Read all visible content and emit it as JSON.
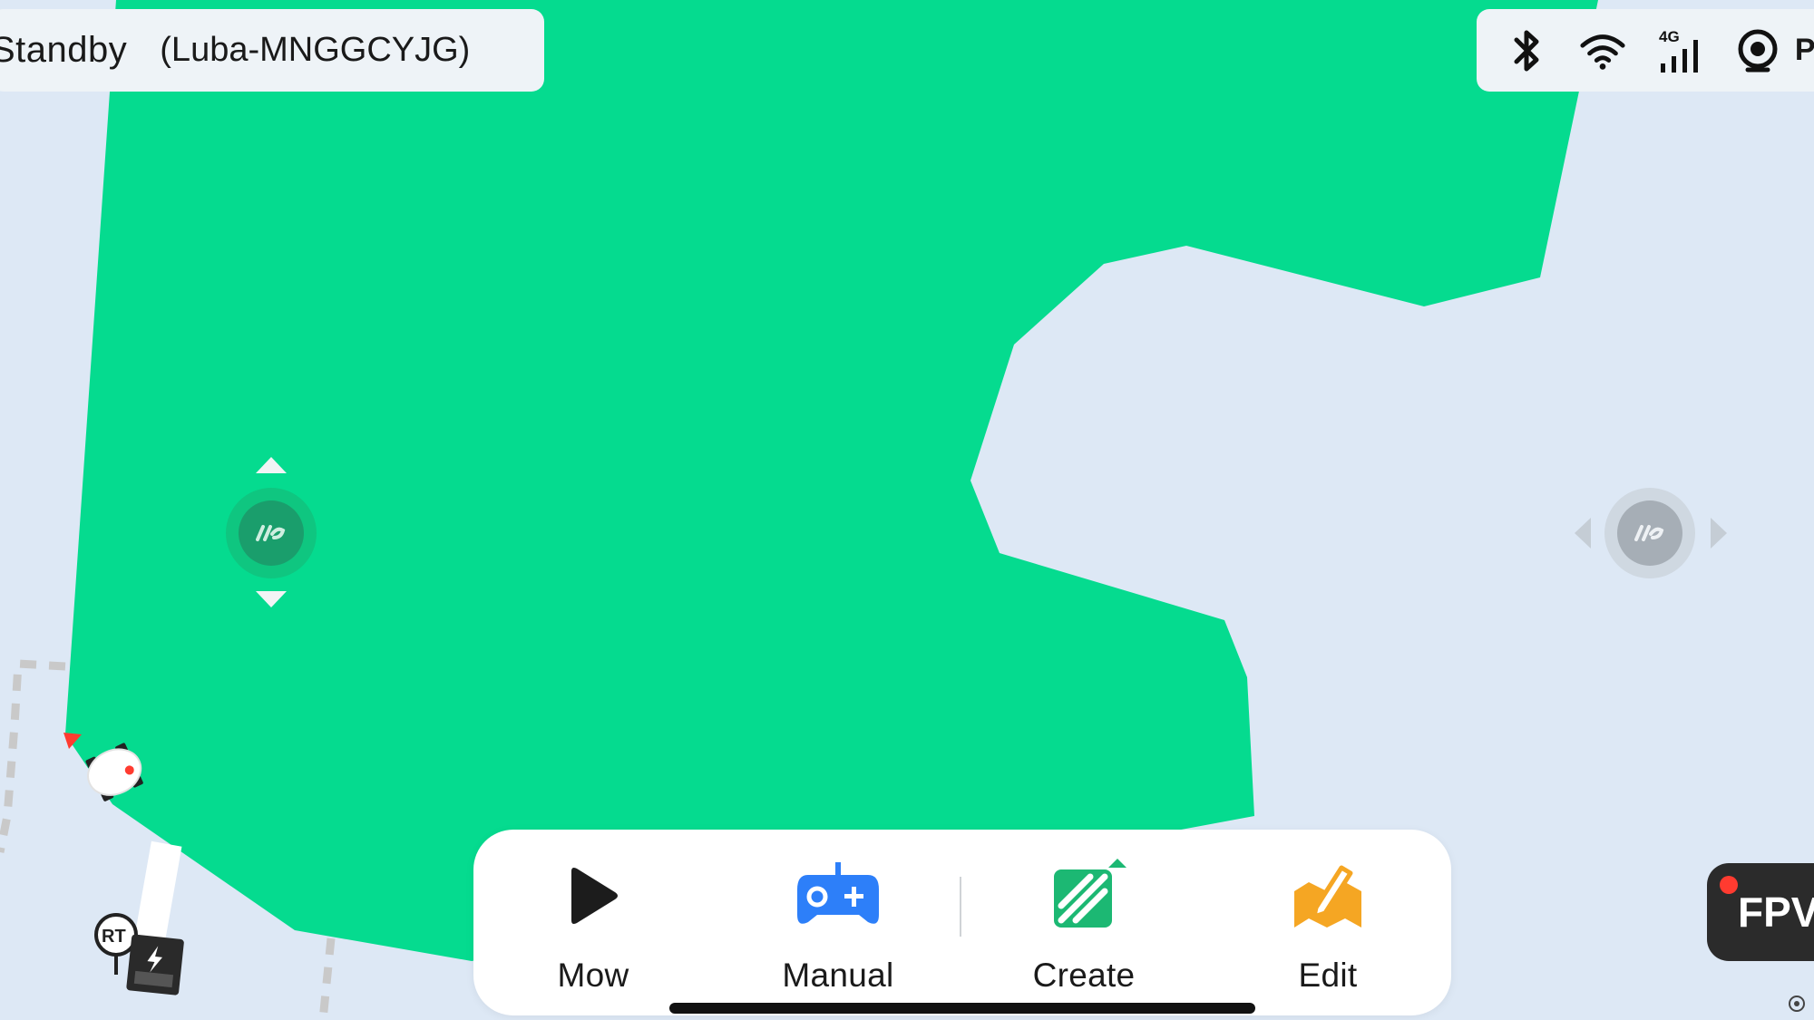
{
  "status_bar": {
    "state": "Standby",
    "device": "(Luba-MNGGCYJG)"
  },
  "connectivity": {
    "icons": [
      "bluetooth-icon",
      "wifi-icon",
      "4g-signal-icon",
      "position-icon"
    ],
    "cellular_label": "4G",
    "position_text": "PO"
  },
  "map": {
    "zone_color": "#05db8f",
    "background_color": "#dde8f5",
    "markers": [
      "mower-icon",
      "rtk-base-charging-station-icon"
    ],
    "rtk_label": "RT"
  },
  "bottom_actions": [
    {
      "label": "Mow",
      "icon": "play-icon"
    },
    {
      "label": "Manual",
      "icon": "gamepad-icon"
    },
    {
      "label": "Create",
      "icon": "create-zone-icon"
    },
    {
      "label": "Edit",
      "icon": "edit-map-icon"
    }
  ],
  "fpv": {
    "label": "FPV",
    "indicator_color": "#ff3b30"
  },
  "colors": {
    "accent_green": "#05db8f",
    "joystick_green": "#1a9e6c",
    "joystick_gray": "#a6aeb6",
    "manual_blue": "#2d7ff9",
    "create_green": "#1cb873",
    "edit_orange": "#f5a623"
  }
}
